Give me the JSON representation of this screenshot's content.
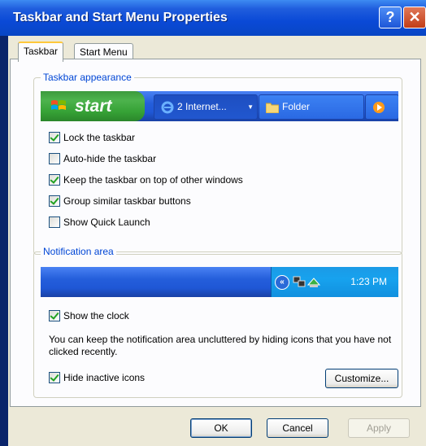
{
  "window": {
    "title": "Taskbar and Start Menu Properties",
    "help_glyph": "?",
    "close_glyph": "✕"
  },
  "tabs": [
    {
      "label": "Taskbar",
      "active": true
    },
    {
      "label": "Start Menu",
      "active": false
    }
  ],
  "taskbar_appearance": {
    "legend": "Taskbar appearance",
    "preview": {
      "start_label": "start",
      "task_buttons": [
        "2 Internet...",
        "Folder"
      ]
    },
    "options": [
      {
        "label": "Lock the taskbar",
        "checked": true
      },
      {
        "label": "Auto-hide the taskbar",
        "checked": false
      },
      {
        "label": "Keep the taskbar on top of other windows",
        "checked": true
      },
      {
        "label": "Group similar taskbar buttons",
        "checked": true
      },
      {
        "label": "Show Quick Launch",
        "checked": false
      }
    ]
  },
  "notification_area": {
    "legend": "Notification area",
    "preview": {
      "clock": "1:23 PM",
      "chevron": "«"
    },
    "show_clock": {
      "label": "Show the clock",
      "checked": true
    },
    "description": "You can keep the notification area uncluttered by hiding icons that you have not clicked recently.",
    "hide_inactive": {
      "label": "Hide inactive icons",
      "checked": true
    },
    "customize_label": "Customize..."
  },
  "footer": {
    "ok_label": "OK",
    "cancel_label": "Cancel",
    "apply_label": "Apply"
  },
  "colors": {
    "title_bar": "#0a49d6",
    "dialog_bg": "#ece9d8",
    "group_legend": "#0046d5",
    "checkmark": "#21a121"
  }
}
